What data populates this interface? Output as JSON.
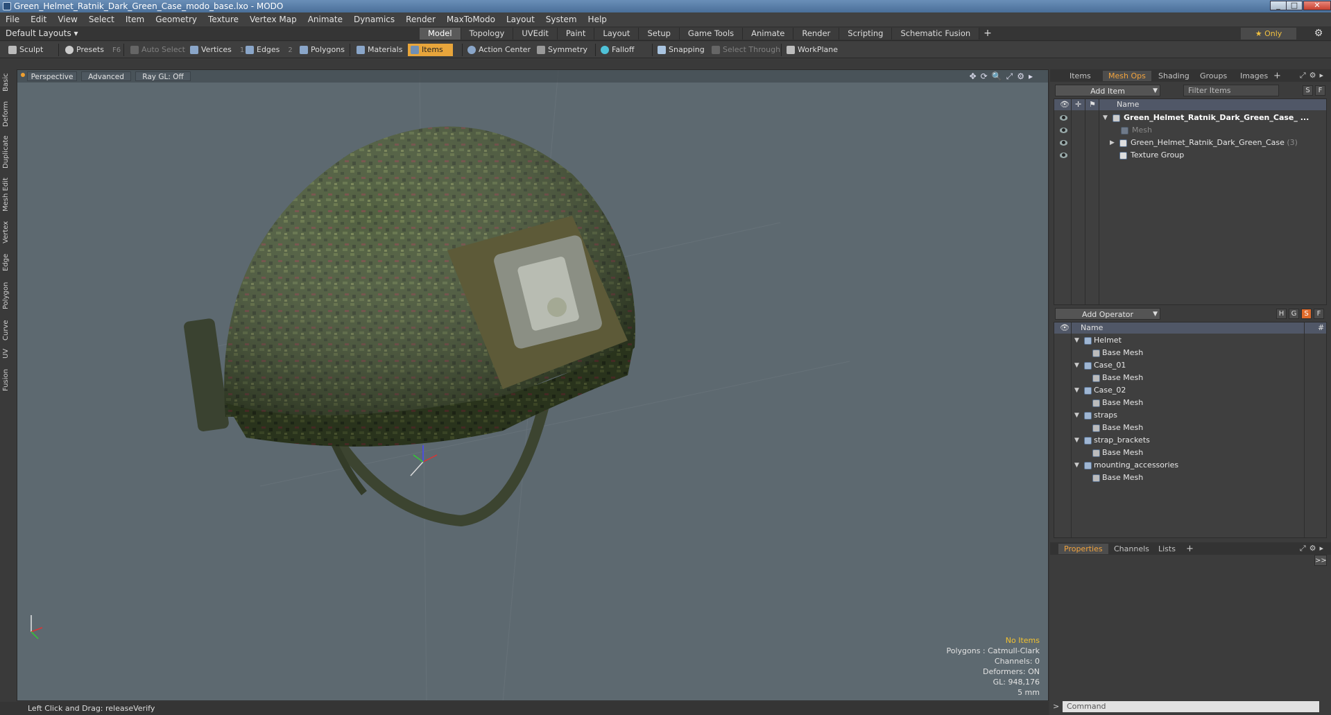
{
  "window": {
    "title": "Green_Helmet_Ratnik_Dark_Green_Case_modo_base.lxo - MODO",
    "controls": [
      "_",
      "□",
      "✕"
    ]
  },
  "menu": [
    "File",
    "Edit",
    "View",
    "Select",
    "Item",
    "Geometry",
    "Texture",
    "Vertex Map",
    "Animate",
    "Dynamics",
    "Render",
    "MaxToModo",
    "Layout",
    "System",
    "Help"
  ],
  "layoutbar": {
    "layout_label": "Default Layouts ▾",
    "tabs": [
      "Model",
      "Topology",
      "UVEdit",
      "Paint",
      "Layout",
      "Setup",
      "Game Tools",
      "Animate",
      "Render",
      "Scripting",
      "Schematic Fusion"
    ],
    "active_tab": "Model",
    "add_tab": "+",
    "only_label": "★  Only"
  },
  "toolbar": {
    "sculpt": "Sculpt",
    "presets": "Presets",
    "presets_key": "F6",
    "auto_select": "Auto Select",
    "vertices": "Vertices",
    "vertices_count": "1",
    "edges": "Edges",
    "edges_count": "2",
    "polygons": "Polygons",
    "materials": "Materials",
    "items": "Items",
    "action_center": "Action Center",
    "symmetry": "Symmetry",
    "falloff": "Falloff",
    "snapping": "Snapping",
    "select_through": "Select Through",
    "workplane": "WorkPlane"
  },
  "left_tabs": [
    "Basic",
    "Deform",
    "Duplicate",
    "Mesh Edit",
    "Vertex",
    "Edge",
    "Polygon",
    "Curve",
    "UV",
    "Fusion"
  ],
  "viewport": {
    "view_mode": "Perspective",
    "shading": "Advanced",
    "raygl": "Ray GL: Off",
    "info": {
      "no_items": "No Items",
      "polygons": "Polygons : Catmull-Clark",
      "channels": "Channels: 0",
      "deformers": "Deformers: ON",
      "gl": "GL: 948,176",
      "scale": "5 mm"
    }
  },
  "status": {
    "text": "Left Click and Drag:   releaseVerify"
  },
  "right_panel": {
    "tabs": [
      "Items",
      "Mesh Ops",
      "Shading",
      "Groups",
      "Images"
    ],
    "active_tab": "Mesh Ops",
    "add_item": "Add Item",
    "filter_placeholder": "Filter Items",
    "s_btn": "S",
    "f_btn": "F",
    "items_header": "Name",
    "items": [
      {
        "label": "Green_Helmet_Ratnik_Dark_Green_Case_ ...",
        "count": ""
      },
      {
        "label": "Mesh",
        "count": ""
      },
      {
        "label": "Green_Helmet_Ratnik_Dark_Green_Case",
        "count": "(3)"
      },
      {
        "label": "Texture Group",
        "count": ""
      }
    ],
    "add_operator": "Add Operator",
    "op_btns": [
      "H",
      "G",
      "S",
      "F"
    ],
    "ops_header": "Name",
    "ops_hash": "#",
    "ops": [
      {
        "label": "Helmet",
        "child": "Base Mesh"
      },
      {
        "label": "Case_01",
        "child": "Base Mesh"
      },
      {
        "label": "Case_02",
        "child": "Base Mesh"
      },
      {
        "label": "straps",
        "child": "Base Mesh"
      },
      {
        "label": "strap_brackets",
        "child": "Base Mesh"
      },
      {
        "label": "mounting_accessories",
        "child": "Base Mesh"
      }
    ],
    "bottom_tabs": [
      "Properties",
      "Channels",
      "Lists"
    ],
    "bottom_active": "Properties",
    "command_placeholder": "Command",
    "collapse": ">>"
  }
}
